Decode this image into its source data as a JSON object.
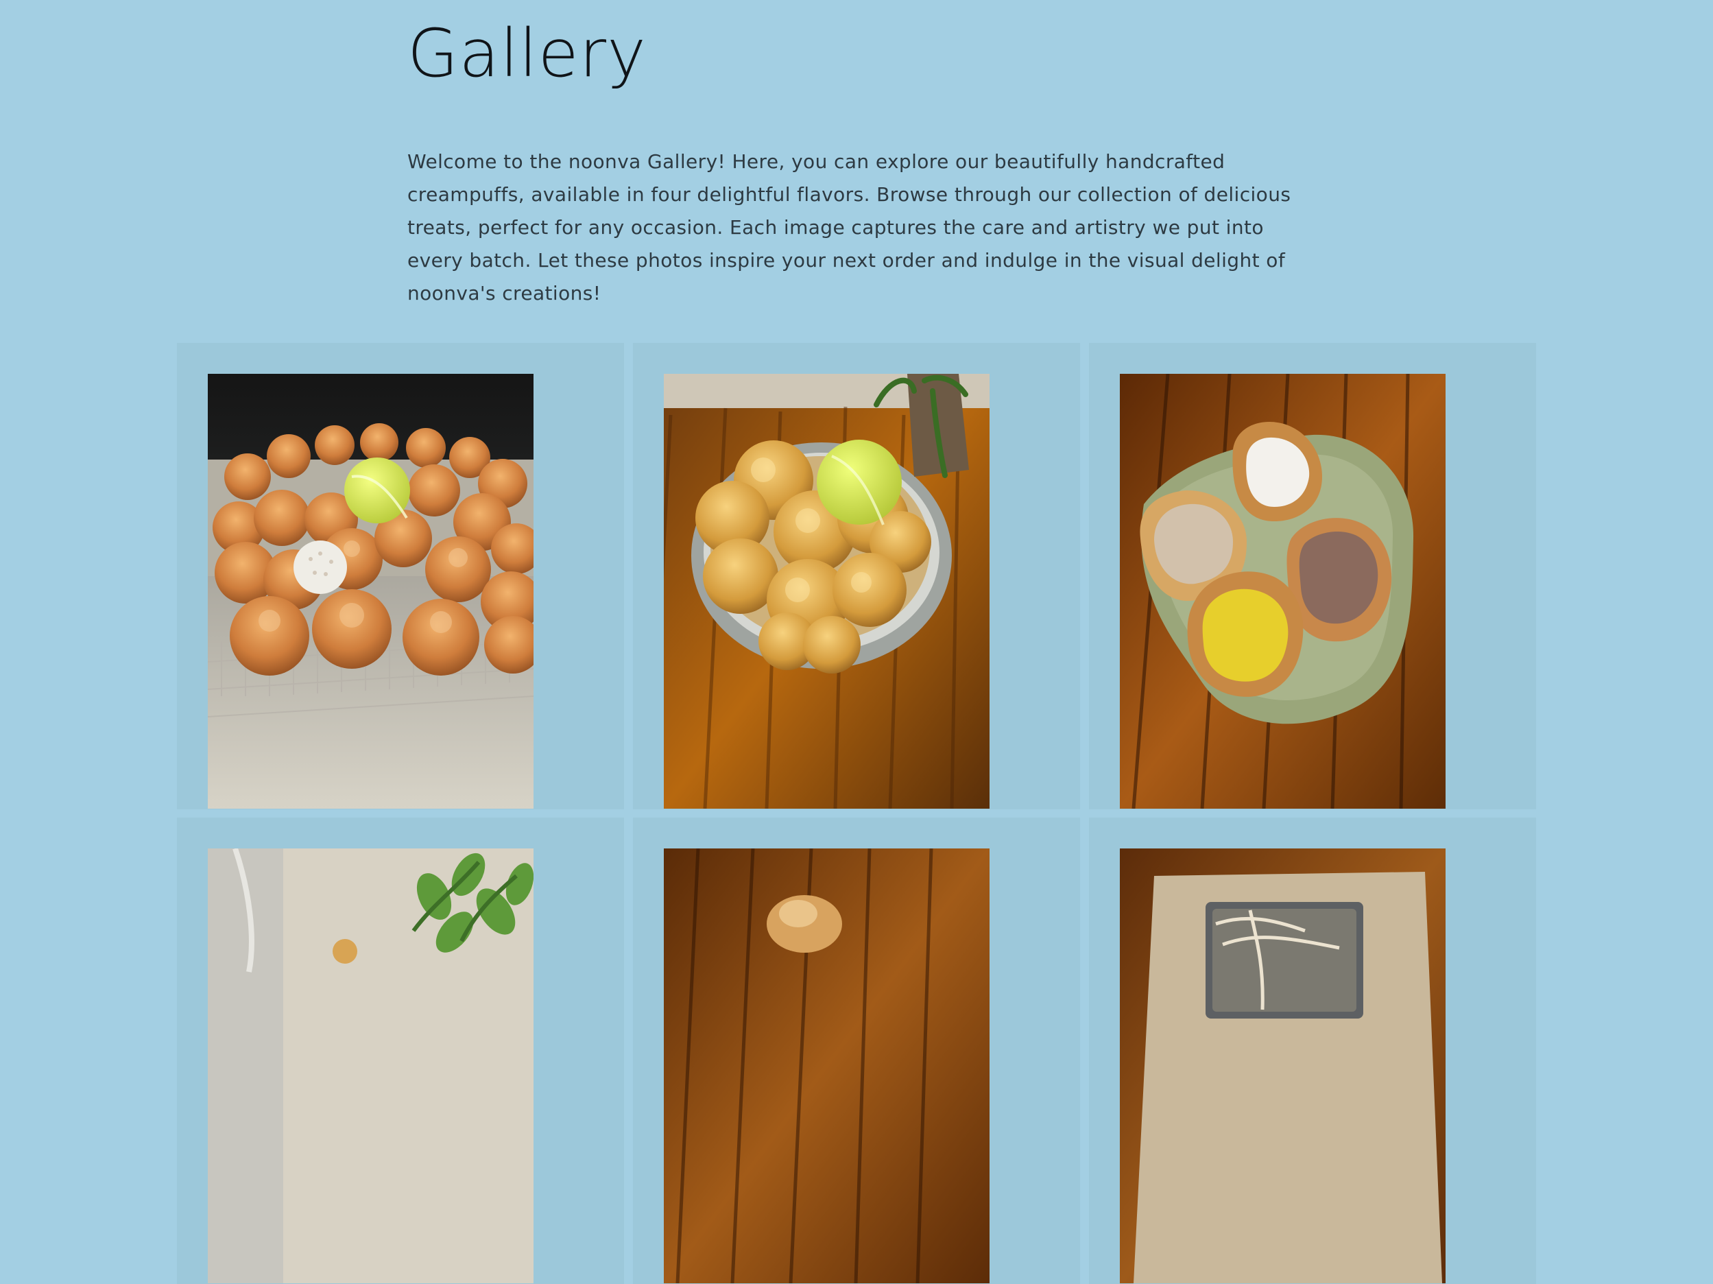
{
  "page": {
    "title": "Gallery",
    "intro": "Welcome to the noonva Gallery! Here, you can explore our beautifully handcrafted creampuffs, available in four delightful flavors. Browse through our collection of delicious treats, perfect for any occasion. Each image captures the care and artistry we put into every batch. Let these photos inspire your next order and indulge in the visual delight of noonva's creations!"
  },
  "colors": {
    "background": "#a3cfe3",
    "card": "#9cc8da",
    "title": "#101418",
    "text": "#2d3a42"
  }
}
